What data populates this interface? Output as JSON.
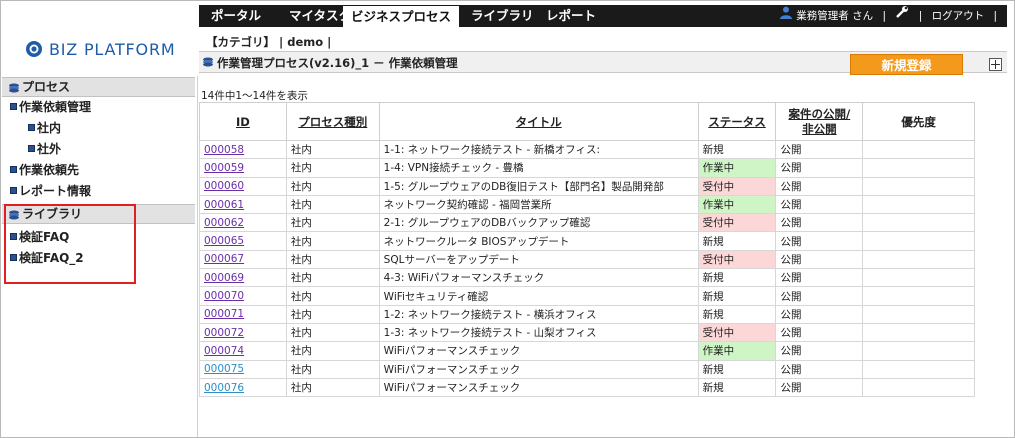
{
  "nav": {
    "items": [
      "ポータル",
      "マイタスク",
      "ビジネスプロセス",
      "ライブラリ",
      "レポート"
    ],
    "active": "ビジネスプロセス",
    "user": "業務管理者 さん",
    "separator": "|",
    "logout": "ログアウト"
  },
  "logo": {
    "text": "BIZ PLATFORM"
  },
  "header": {
    "category": "【カテゴリ】 | demo |",
    "path": "作業管理プロセス(v2.16)_1 － 作業依頼管理",
    "new_button": "新規登録"
  },
  "sidebar": {
    "process_heading": "プロセス",
    "process_items": [
      {
        "label": "作業依頼管理",
        "level": 1
      },
      {
        "label": "社内",
        "level": 2
      },
      {
        "label": "社外",
        "level": 2
      },
      {
        "label": "作業依頼先",
        "level": 1
      },
      {
        "label": "レポート情報",
        "level": 1
      }
    ],
    "library_heading": "ライブラリ",
    "library_items": [
      {
        "label": "検証FAQ",
        "level": 1
      },
      {
        "label": "検証FAQ_2",
        "level": 1
      }
    ]
  },
  "list": {
    "count_text": "14件中1～14件を表示",
    "headers": [
      "ID",
      "プロセス種別",
      "タイトル",
      "ステータス",
      "案件の公開/\n非公開",
      "優先度"
    ],
    "rows": [
      {
        "id": "000058",
        "type": "社内",
        "title": "1-1: ネットワーク接続テスト - 新橋オフィス:",
        "status": "新規",
        "pub": "公開",
        "priority": ""
      },
      {
        "id": "000059",
        "type": "社内",
        "title": "1-4: VPN接続チェック - 豊橋",
        "status": "作業中",
        "pub": "公開",
        "priority": ""
      },
      {
        "id": "000060",
        "type": "社内",
        "title": "1-5: グループウェアのDB復旧テスト【部門名】製品開発部",
        "status": "受付中",
        "pub": "公開",
        "priority": ""
      },
      {
        "id": "000061",
        "type": "社内",
        "title": "ネットワーク契約確認 - 福岡営業所",
        "status": "作業中",
        "pub": "公開",
        "priority": ""
      },
      {
        "id": "000062",
        "type": "社内",
        "title": "2-1: グループウェアのDBバックアップ確認",
        "status": "受付中",
        "pub": "公開",
        "priority": ""
      },
      {
        "id": "000065",
        "type": "社内",
        "title": "ネットワークルータ BIOSアップデート",
        "status": "新規",
        "pub": "公開",
        "priority": ""
      },
      {
        "id": "000067",
        "type": "社内",
        "title": "SQLサーバーをアップデート",
        "status": "受付中",
        "pub": "公開",
        "priority": ""
      },
      {
        "id": "000069",
        "type": "社内",
        "title": "4-3: WiFiパフォーマンスチェック",
        "status": "新規",
        "pub": "公開",
        "priority": ""
      },
      {
        "id": "000070",
        "type": "社内",
        "title": "WiFiセキュリティ確認",
        "status": "新規",
        "pub": "公開",
        "priority": ""
      },
      {
        "id": "000071",
        "type": "社内",
        "title": "1-2: ネットワーク接続テスト - 横浜オフィス",
        "status": "新規",
        "pub": "公開",
        "priority": ""
      },
      {
        "id": "000072",
        "type": "社内",
        "title": "1-3: ネットワーク接続テスト - 山梨オフィス",
        "status": "受付中",
        "pub": "公開",
        "priority": ""
      },
      {
        "id": "000074",
        "type": "社内",
        "title": "WiFiパフォーマンスチェック",
        "status": "作業中",
        "pub": "公開",
        "priority": ""
      },
      {
        "id": "000075",
        "type": "社内",
        "title": "WiFiパフォーマンスチェック",
        "status": "新規",
        "pub": "公開",
        "priority": ""
      },
      {
        "id": "000076",
        "type": "社内",
        "title": "WiFiパフォーマンスチェック",
        "status": "新規",
        "pub": "公開",
        "priority": ""
      }
    ]
  },
  "colors": {
    "nav_bg": "#1a1a1a",
    "accent_orange": "#f39a1c",
    "status_in_progress": "#cff5c6",
    "status_accepted": "#fbd7d7",
    "highlight_box": "#e02020",
    "logo_blue": "#1f5ca8"
  }
}
